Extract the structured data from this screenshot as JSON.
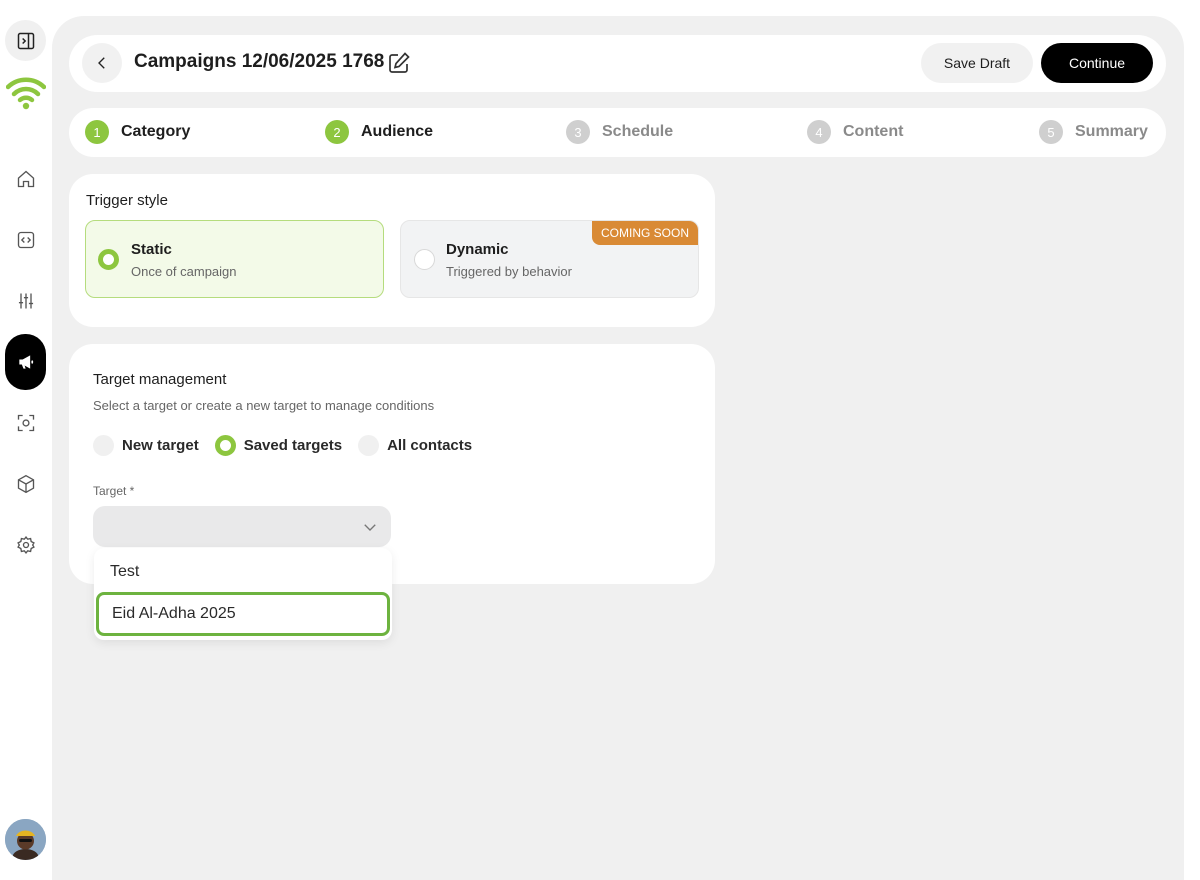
{
  "header": {
    "title": "Campaigns 12/06/2025 1768",
    "save_label": "Save Draft",
    "continue_label": "Continue"
  },
  "steps": [
    {
      "num": "1",
      "label": "Category",
      "state": "done"
    },
    {
      "num": "2",
      "label": "Audience",
      "state": "done"
    },
    {
      "num": "3",
      "label": "Schedule",
      "state": "pending"
    },
    {
      "num": "4",
      "label": "Content",
      "state": "pending"
    },
    {
      "num": "5",
      "label": "Summary",
      "state": "pending"
    }
  ],
  "trigger": {
    "title": "Trigger style",
    "options": [
      {
        "title": "Static",
        "subtitle": "Once of campaign",
        "selected": true
      },
      {
        "title": "Dynamic",
        "subtitle": "Triggered by behavior",
        "badge": "COMING SOON",
        "selected": false
      }
    ]
  },
  "target": {
    "title": "Target management",
    "subtitle": "Select a target or create a new target to manage conditions",
    "radios": [
      {
        "label": "New target",
        "selected": false
      },
      {
        "label": "Saved targets",
        "selected": true
      },
      {
        "label": "All contacts",
        "selected": false
      }
    ],
    "field_label": "Target *",
    "dropdown": [
      "Test",
      "Eid Al-Adha 2025"
    ]
  },
  "sidebar": {
    "icons": [
      "panel-toggle-icon",
      "wifi-logo-icon",
      "home-icon",
      "code-icon",
      "sliders-icon",
      "megaphone-icon",
      "scan-icon",
      "cube-icon",
      "gear-icon"
    ]
  },
  "colors": {
    "accent_green": "#8dc63f",
    "badge_orange": "#d98a35",
    "primary_black": "#000000"
  }
}
